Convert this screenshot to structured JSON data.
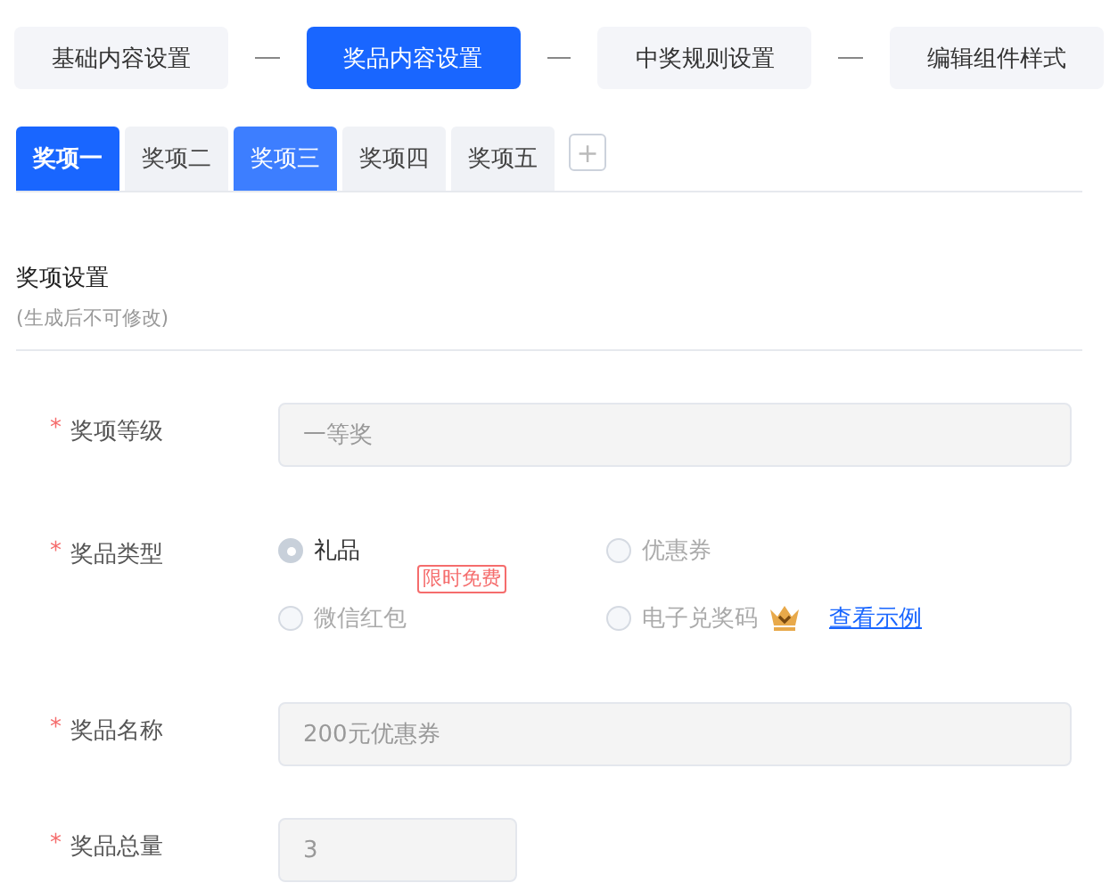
{
  "steps": [
    {
      "label": "基础内容设置",
      "selected": false
    },
    {
      "label": "奖品内容设置",
      "selected": true
    },
    {
      "label": "中奖规则设置",
      "selected": false
    },
    {
      "label": "编辑组件样式",
      "selected": false
    }
  ],
  "prize_tabs": [
    {
      "label": "奖项一",
      "selected": true,
      "hover": false
    },
    {
      "label": "奖项二",
      "selected": false,
      "hover": false
    },
    {
      "label": "奖项三",
      "selected": false,
      "hover": true
    },
    {
      "label": "奖项四",
      "selected": false,
      "hover": false
    },
    {
      "label": "奖项五",
      "selected": false,
      "hover": false
    }
  ],
  "add_tab": {
    "label": "+"
  },
  "section": {
    "title": "奖项设置",
    "subtitle": "(生成后不可修改)"
  },
  "fields": [
    {
      "kind": "text",
      "label": "奖项等级",
      "required_mark": "*",
      "value": "一等奖",
      "disabled": true,
      "wide": true
    },
    {
      "kind": "radio",
      "label": "奖品类型",
      "required_mark": "*",
      "disabled": true,
      "options": [
        {
          "label": "礼品",
          "selected": true
        },
        {
          "label": "优惠券",
          "selected": false
        },
        {
          "label": "微信红包",
          "selected": false,
          "badge": "限时免费"
        },
        {
          "label": "电子兑奖码",
          "selected": false,
          "premium": true,
          "link": "查看示例"
        }
      ]
    },
    {
      "kind": "text",
      "label": "奖品名称",
      "required_mark": "*",
      "value": "200元优惠券",
      "disabled": true,
      "wide": true
    },
    {
      "kind": "text",
      "label": "奖品总量",
      "required_mark": "*",
      "value": "3",
      "disabled": true,
      "wide": false
    }
  ]
}
